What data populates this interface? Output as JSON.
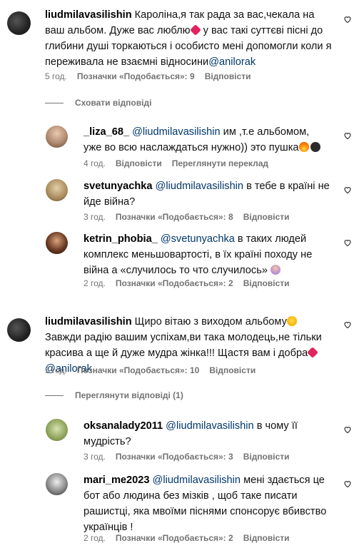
{
  "comments": [
    {
      "user": "liudmilavasilishin",
      "text_a": "Кароліна,я так рада за вас,чекала на ваш альбом. Дуже вас люблю",
      "text_b": " у вас такі суттєві пісні до глибини душі торкаються і особисто мені допомогли коли я переживала не взаємні відносини",
      "mention": "@anilorak",
      "time": "5 год.",
      "likes": "Позначки «Подобається»: 9",
      "reply": "Відповісти"
    },
    {
      "user": "_liza_68_",
      "mention": "@liudmilavasilishin",
      "text": " им ,т.е альбомом, уже во всю наслаждаться нужно)) это пушка",
      "time": "4 год.",
      "reply": "Відповісти",
      "translate": "Переглянути переклад"
    },
    {
      "user": "svetunyachka",
      "mention": "@liudmilavasilishin",
      "text": " в тебе в країні не йде війна?",
      "time": "3 год.",
      "likes": "Позначки «Подобається»: 8",
      "reply": "Відповісти"
    },
    {
      "user": "ketrin_phobia_",
      "mention": "@svetunyachka",
      "text": " в таких людей комплекс меньшовартості, в їх країні походу не війна а «случилось то что случилось»",
      "time": "2 год.",
      "likes": "Позначки «Подобається»: 2",
      "reply": "Відповісти"
    },
    {
      "user": "liudmilavasilishin",
      "text_a": "Щиро вітаю з виходом альбому",
      "text_b": " Завжди радію вашим успіхам,ви така молодець,не тільки красива а ще й дуже мудра жінка!!! Щастя вам і добра",
      "mention": "@anilorak",
      "time": "5 год.",
      "likes": "Позначки «Подобається»: 10",
      "reply": "Відповісти"
    },
    {
      "user": "oksanalady2011",
      "mention": "@liudmilavasilishin",
      "text": " в чому її мудрість?",
      "time": "3 год.",
      "likes": "Позначки «Подобається»: 3",
      "reply": "Відповісти"
    },
    {
      "user": "mari_me2023",
      "mention": "@liudmilavasilishin",
      "text": " мені здається це бот або людина без мізків , щоб таке писати рашистці, яка мвоїми піснями спонсорує вбивство українців !",
      "time": "2 год.",
      "likes": "Позначки «Подобається»: 2",
      "reply": "Відповісти"
    }
  ],
  "hide_replies": "Сховати відповіді",
  "view_replies": "Переглянути відповіді (1)",
  "colors": {
    "mention": "#00376b",
    "meta": "#737373",
    "text": "#111111"
  },
  "icons": [
    "heart-outline-icon",
    "red-heart-emoji",
    "fire-emoji",
    "bomb-emoji",
    "facepalm-emoji",
    "star-eyes-emoji"
  ]
}
